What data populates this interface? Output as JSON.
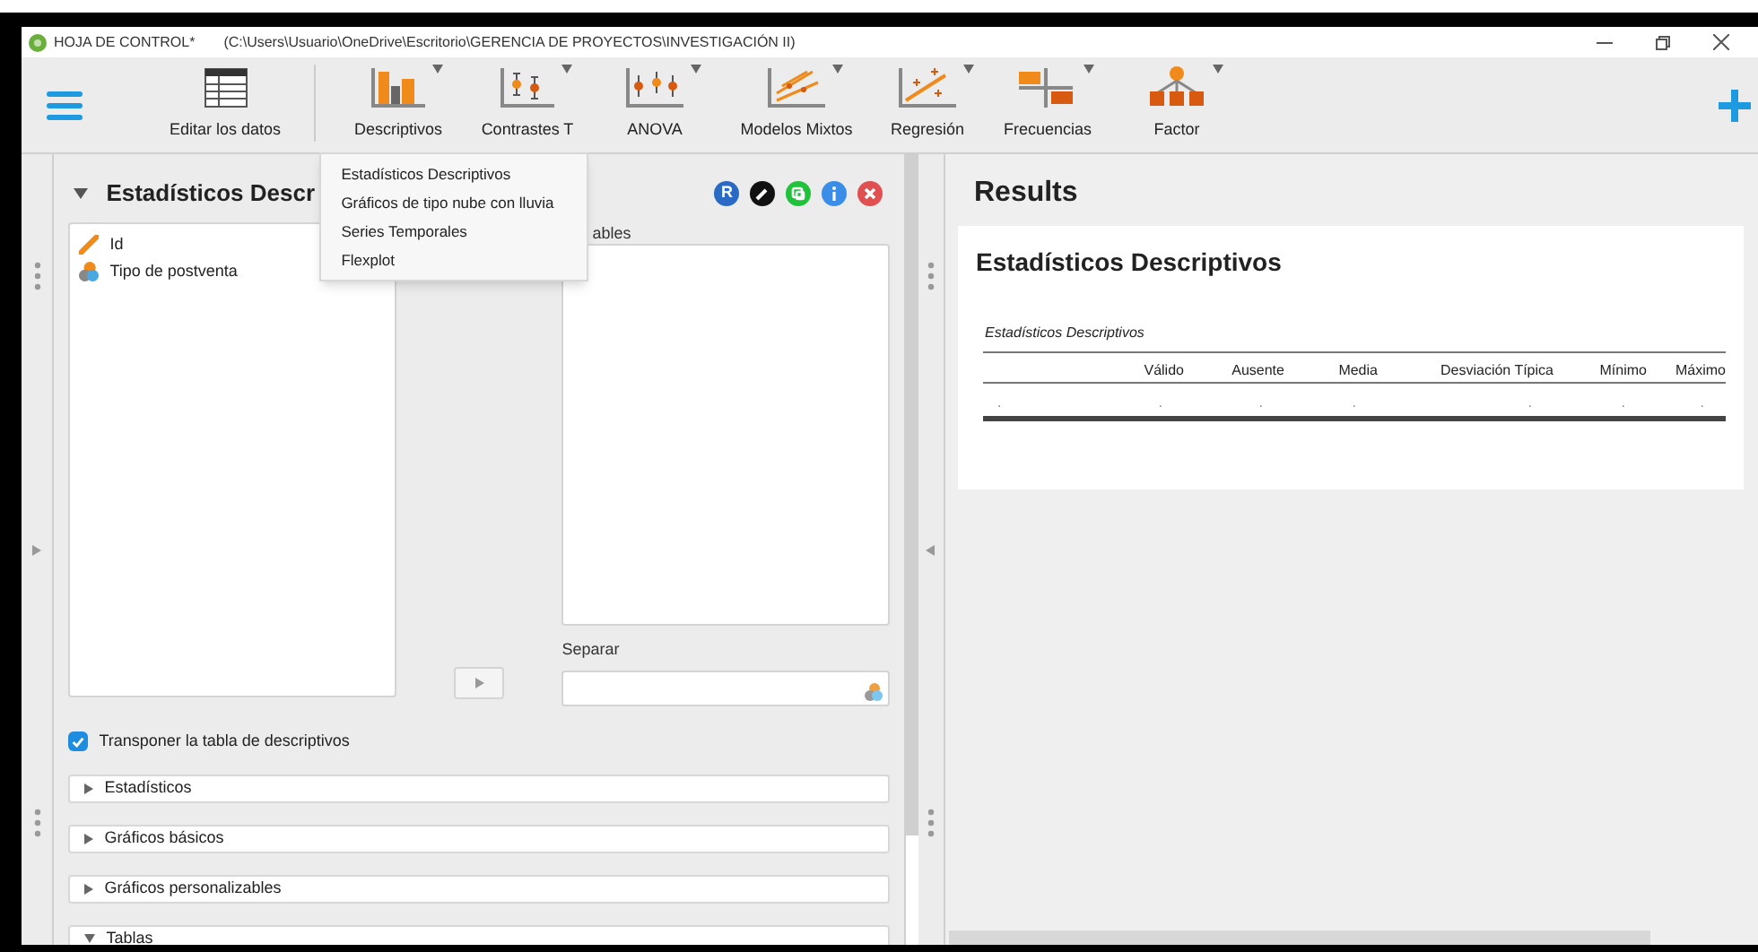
{
  "window": {
    "title": "HOJA DE CONTROL*",
    "path": "(C:\\Users\\Usuario\\OneDrive\\Escritorio\\GERENCIA DE PROYECTOS\\INVESTIGACIÓN II)"
  },
  "toolbar": [
    {
      "label": "Editar los datos",
      "kind": "table",
      "dropdown": false
    },
    {
      "label": "Descriptivos",
      "kind": "bars",
      "dropdown": true
    },
    {
      "label": "Contrastes T",
      "kind": "ttest",
      "dropdown": true
    },
    {
      "label": "ANOVA",
      "kind": "anova",
      "dropdown": true
    },
    {
      "label": "Modelos Mixtos",
      "kind": "mixed",
      "dropdown": true
    },
    {
      "label": "Regresión",
      "kind": "regression",
      "dropdown": true
    },
    {
      "label": "Frecuencias",
      "kind": "freq",
      "dropdown": true
    },
    {
      "label": "Factor",
      "kind": "factor",
      "dropdown": true
    }
  ],
  "menu": [
    "Estadísticos Descriptivos",
    "Gráficos de tipo nube con lluvia",
    "Series Temporales",
    "Flexplot"
  ],
  "analysis": {
    "title": "Estadísticos Descr",
    "badge": "R",
    "variables": [
      {
        "name": "Id",
        "kind": "scale"
      },
      {
        "name": "Tipo de postventa",
        "kind": "nominal"
      }
    ],
    "target_label": "ables",
    "split_label": "Separar",
    "checkbox": {
      "label": "Transponer la tabla de descriptivos",
      "checked": true
    },
    "sections": [
      {
        "label": "Estadísticos",
        "expanded": false
      },
      {
        "label": "Gráficos básicos",
        "expanded": false
      },
      {
        "label": "Gráficos personalizables",
        "expanded": false
      },
      {
        "label": "Tablas",
        "expanded": true
      }
    ]
  },
  "results": {
    "heading": "Results",
    "title": "Estadísticos Descriptivos",
    "caption": "Estadísticos Descriptivos",
    "columns": [
      "",
      "Válido",
      "Ausente",
      "Media",
      "Desviación Típica",
      "Mínimo",
      "Máximo"
    ],
    "rows": [
      [
        ".",
        ".",
        ".",
        ".",
        ".",
        ".",
        "."
      ]
    ]
  }
}
